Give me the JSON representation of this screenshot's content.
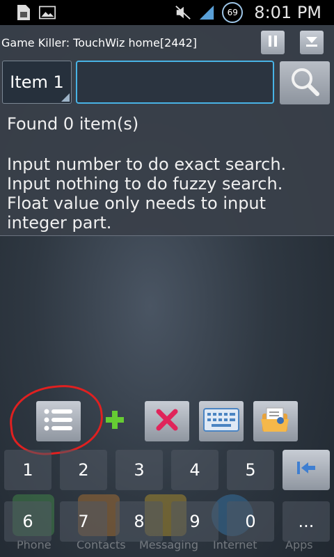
{
  "status_bar": {
    "time": "8:01 PM",
    "battery": "69",
    "icons": [
      "sim-icon",
      "image-icon",
      "mute-icon",
      "signal-icon"
    ]
  },
  "header": {
    "title": "Game Killer: TouchWiz home[2442]",
    "pause_icon": "pause-icon",
    "minimize_icon": "minimize-icon"
  },
  "search": {
    "item_label": "Item 1",
    "value": "",
    "placeholder": ""
  },
  "results": {
    "found_text": "Found 0 item(s)",
    "hint_lines": [
      "Input number to do exact search.",
      "Input nothing to do fuzzy search.",
      "Float value only needs to input integer part."
    ]
  },
  "tools": [
    "list-icon",
    "plus-icon",
    "close-icon",
    "keyboard-icon",
    "folder-icon"
  ],
  "keypad": {
    "row1": [
      "1",
      "2",
      "3",
      "4",
      "5"
    ],
    "row2": [
      "6",
      "7",
      "8",
      "9",
      "0"
    ],
    "more_label": "..."
  },
  "dock": [
    "Phone",
    "Contacts",
    "Messaging",
    "Internet",
    "Apps"
  ],
  "colors": {
    "accent": "#48b3e6",
    "annotation": "#e02020",
    "plus": "#66cc33",
    "delete": "#e0245a"
  }
}
